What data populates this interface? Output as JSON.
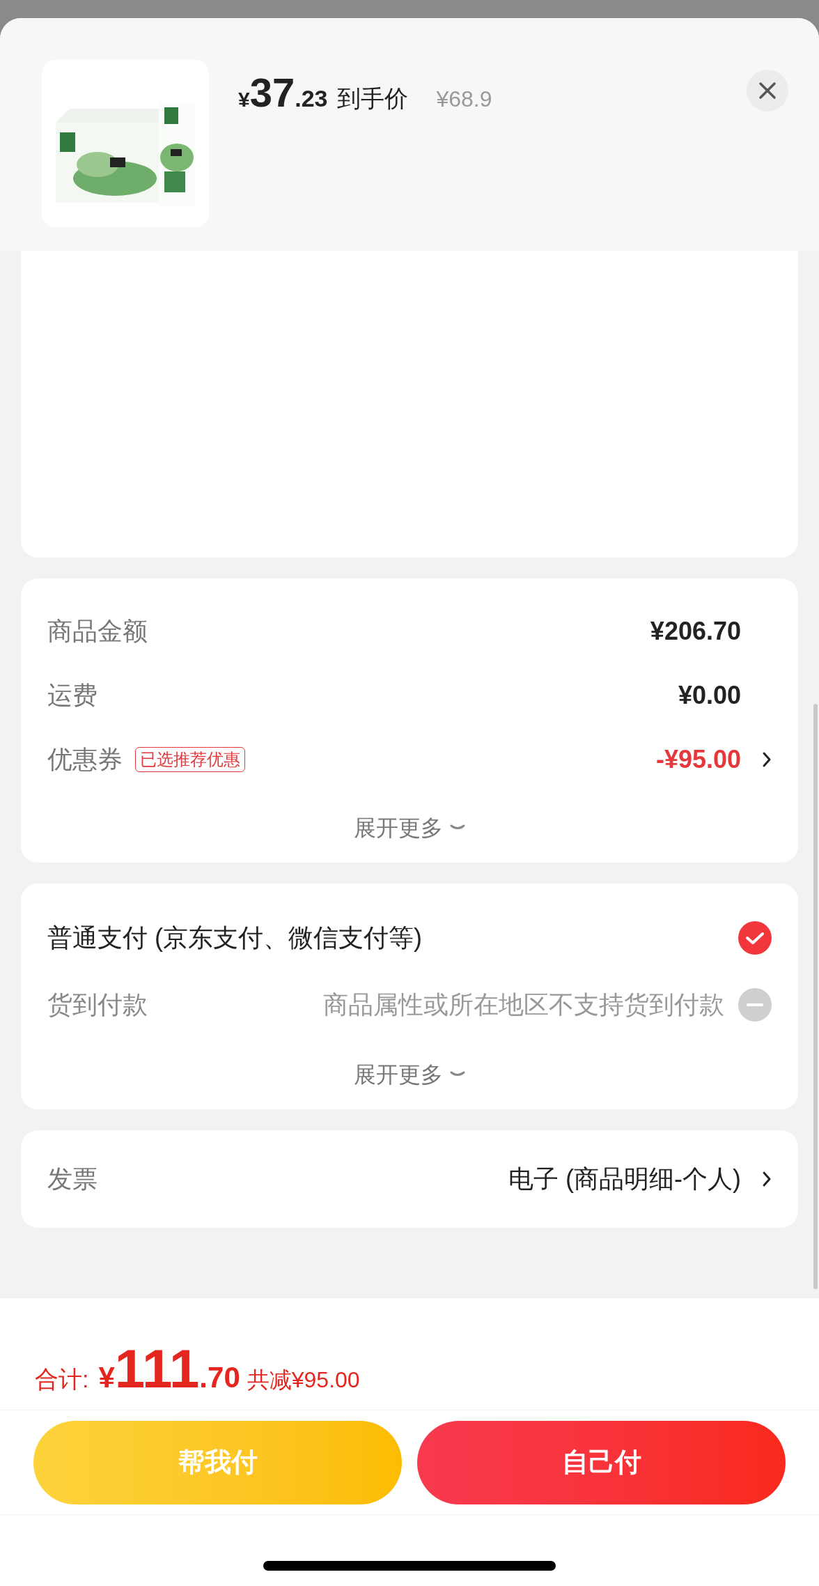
{
  "product": {
    "kind": "picture",
    "currency": "¥",
    "price_int": "37",
    "price_dec": ".23",
    "price_label": "到手价",
    "original_price": "¥68.9"
  },
  "summary": {
    "rows": [
      {
        "kind": "plain",
        "label": "商品金额",
        "value": "¥206.70",
        "arrow": false
      },
      {
        "kind": "plain",
        "label": "运费",
        "value": "¥0.00",
        "arrow": false
      },
      {
        "kind": "discount",
        "label": "优惠券",
        "tag": "已选推荐优惠",
        "value": "-¥95.00",
        "arrow": true
      }
    ],
    "expand": "展开更多"
  },
  "payment": {
    "options": [
      {
        "label": "普通支付 (京东支付、微信支付等)",
        "selected": true,
        "disabled": false
      },
      {
        "label": "货到付款",
        "note": "商品属性或所在地区不支持货到付款",
        "selected": false,
        "disabled": true
      }
    ],
    "expand": "展开更多"
  },
  "invoice": {
    "label": "发票",
    "value": "电子 (商品明细-个人)"
  },
  "footer": {
    "total_label": "合计:",
    "currency": "¥",
    "total_int": "111",
    "total_dec": ".70",
    "saved": "共减¥95.00",
    "buttons": [
      {
        "kind": "secondary",
        "label": "帮我付"
      },
      {
        "kind": "primary",
        "label": "自己付"
      }
    ]
  }
}
